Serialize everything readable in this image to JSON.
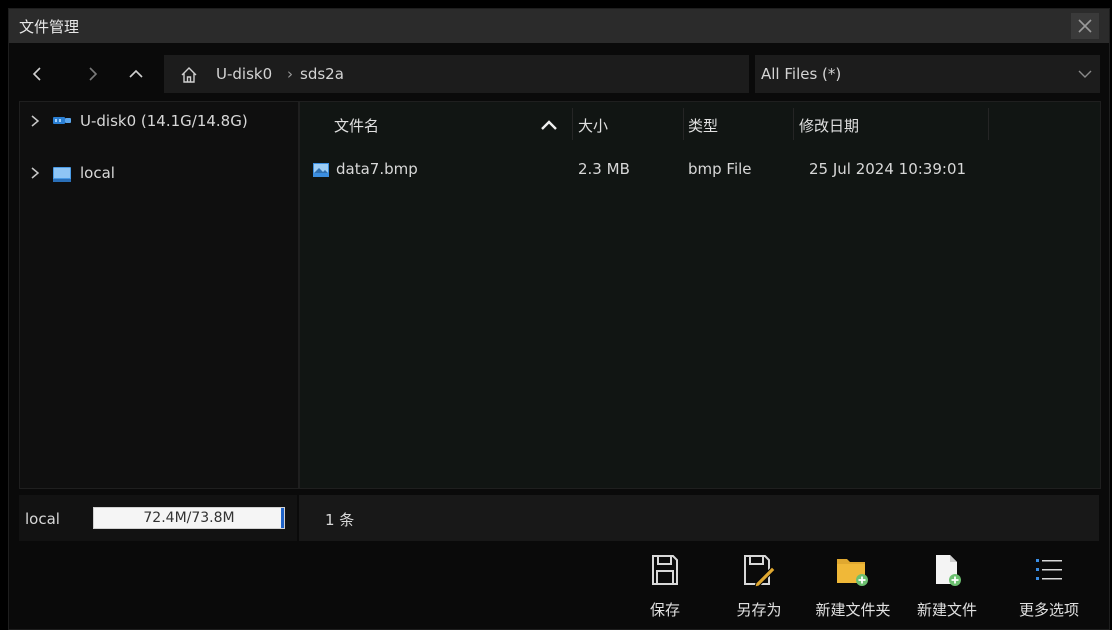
{
  "window": {
    "title": "文件管理"
  },
  "path": {
    "segments": [
      "U-disk0",
      "sds2a"
    ]
  },
  "filter": {
    "selected": "All Files (*)"
  },
  "tree": [
    {
      "label": "U-disk0  (14.1G/14.8G)",
      "icon": "usb-drive-icon"
    },
    {
      "label": "local",
      "icon": "local-drive-icon"
    }
  ],
  "columns": {
    "name": "文件名",
    "size": "大小",
    "type": "类型",
    "modified": "修改日期"
  },
  "files": [
    {
      "name": "data7.bmp",
      "size": "2.3 MB",
      "type": "bmp File",
      "modified": "25 Jul 2024 10:39:01",
      "icon": "image-file-icon"
    }
  ],
  "storage": {
    "label": "local",
    "usage": "72.4M/73.8M",
    "used_fraction": 0.98
  },
  "status": {
    "count": "1 条"
  },
  "toolbar": {
    "save": "保存",
    "save_as": "另存为",
    "new_folder": "新建文件夹",
    "new_file": "新建文件",
    "more": "更多选项"
  },
  "colors": {
    "accent": "#1e62c8",
    "folder": "#e0a830",
    "icon_blue": "#2a7fd4"
  }
}
